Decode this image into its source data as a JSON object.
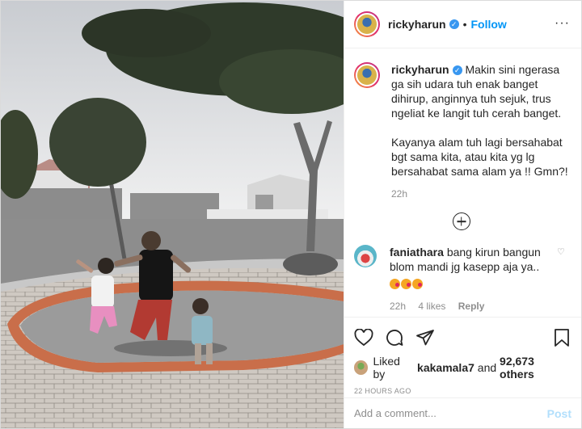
{
  "header": {
    "username": "rickyharun",
    "verified_icon": "verified-badge-icon",
    "separator": "•",
    "follow_label": "Follow",
    "more_label": "···"
  },
  "caption": {
    "username": "rickyharun",
    "para1": "Makin sini ngerasa ga sih udara tuh enak banget dihirup, anginnya tuh sejuk, trus ngeliat ke langit tuh cerah banget.",
    "para2": "Kayanya alam tuh lagi bersahabat bgt sama kita, atau kita yg lg bersahabat sama alam ya !! Gmn?!",
    "time": "22h"
  },
  "load_more_icon": "plus-circle-icon",
  "comment": {
    "username": "faniathara",
    "text": "bang kirun bangun blom mandi jg kasepp aja ya..",
    "emojis": [
      "😘",
      "😘",
      "😘"
    ],
    "time": "22h",
    "likes": "4 likes",
    "reply_label": "Reply"
  },
  "actions": {
    "icons": [
      "heart-icon",
      "comment-icon",
      "share-icon",
      "bookmark-icon"
    ]
  },
  "likes_line": {
    "prefix": "Liked by",
    "user": "kakamala7",
    "middle": "and",
    "count": "92,673 others"
  },
  "timestamp": "22 HOURS AGO",
  "add_comment": {
    "placeholder": "Add a comment...",
    "post_label": "Post"
  },
  "colors": {
    "accent": "#0095f6",
    "post_disabled": "#b2dffc",
    "muted": "#8e8e8e",
    "text": "#262626"
  }
}
